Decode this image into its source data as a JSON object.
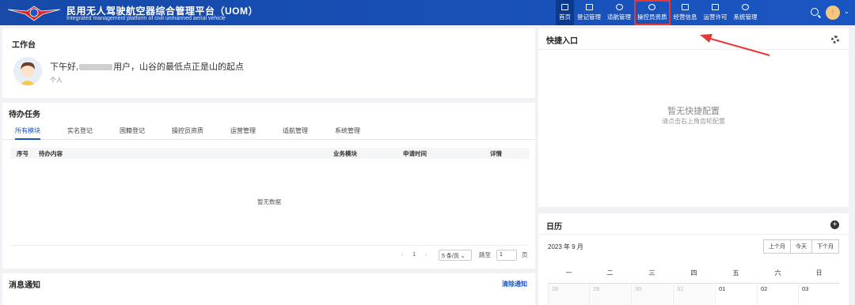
{
  "app": {
    "title": "民用无人驾驶航空器综合管理平台（UOM）",
    "subtitle": "Integrated management platform of civil unmanned aerial vehicle"
  },
  "nav": {
    "items": [
      {
        "label": "首页",
        "active": true
      },
      {
        "label": "登记管理"
      },
      {
        "label": "适航管理"
      },
      {
        "label": "操控员资质",
        "highlighted": true
      },
      {
        "label": "经营信息"
      },
      {
        "label": "运营许可"
      },
      {
        "label": "系统管理"
      }
    ],
    "avatar_text": "!"
  },
  "workbench": {
    "title": "工作台",
    "greeting_prefix": "下午好,",
    "greeting_suffix": "用户，山谷的最低点正是山的起点",
    "role": "个人"
  },
  "todo": {
    "title": "待办任务",
    "tabs": [
      "所有模块",
      "实名登记",
      "国籍登记",
      "操控员资质",
      "运营管理",
      "适航管理",
      "系统管理"
    ],
    "columns": [
      "序号",
      "待办内容",
      "业务模块",
      "申请时间",
      "详情"
    ],
    "empty_text": "暂无数据",
    "pager": {
      "page": "1",
      "page_size": "5 条/页",
      "goto_label": "跳至",
      "goto_value": "1",
      "page_unit": "页"
    }
  },
  "notify": {
    "title": "消息通知",
    "clear_label": "清除通知"
  },
  "quick": {
    "title": "快捷入口",
    "empty_title": "暂无快捷配置",
    "empty_hint": "请点击右上角齿轮配置"
  },
  "calendar": {
    "title": "日历",
    "month": "2023 年 9 月",
    "buttons": [
      "上个月",
      "今天",
      "下个月"
    ],
    "weekdays": [
      "一",
      "二",
      "三",
      "四",
      "五",
      "六",
      "日"
    ],
    "days": [
      "28",
      "29",
      "30",
      "31",
      "01",
      "02",
      "03"
    ]
  },
  "colors": {
    "brand": "#1a56c2",
    "highlight": "#e53935"
  }
}
